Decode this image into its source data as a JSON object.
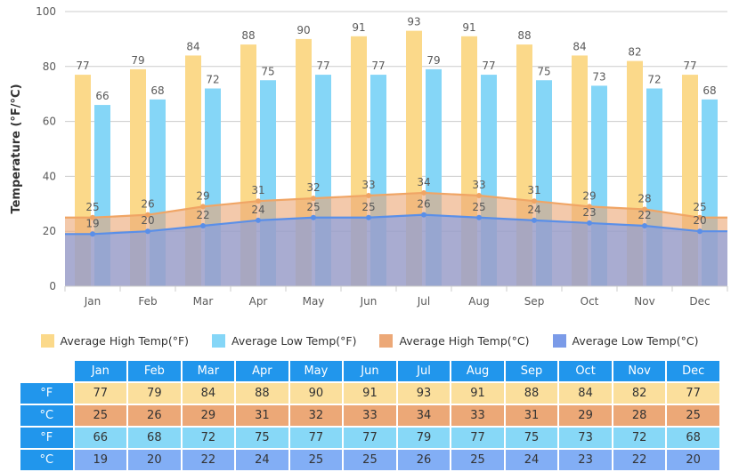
{
  "chart_data": {
    "type": "bar",
    "title": "",
    "xlabel": "",
    "ylabel": "Temperature (°F/°C)",
    "ylim": [
      0,
      100
    ],
    "yticks": [
      0,
      20,
      40,
      60,
      80,
      100
    ],
    "grid": true,
    "legend_position": "bottom",
    "categories": [
      "Jan",
      "Feb",
      "Mar",
      "Apr",
      "May",
      "Jun",
      "Jul",
      "Aug",
      "Sep",
      "Oct",
      "Nov",
      "Dec"
    ],
    "series": [
      {
        "name": "Average High Temp(°F)",
        "type": "bar",
        "color": "#fbd98a",
        "values": [
          77,
          79,
          84,
          88,
          90,
          91,
          93,
          91,
          88,
          84,
          82,
          77
        ]
      },
      {
        "name": "Average Low Temp(°F)",
        "type": "bar",
        "color": "#85d6f7",
        "values": [
          66,
          68,
          72,
          75,
          77,
          77,
          79,
          77,
          75,
          73,
          72,
          68
        ]
      },
      {
        "name": "Average High Temp(°C)",
        "type": "area",
        "color": "#eca877",
        "values": [
          25,
          26,
          29,
          31,
          32,
          33,
          34,
          33,
          31,
          29,
          28,
          25
        ]
      },
      {
        "name": "Average Low Temp(°C)",
        "type": "area",
        "color": "#7b9be8",
        "values": [
          19,
          20,
          22,
          24,
          25,
          25,
          26,
          25,
          24,
          23,
          22,
          20
        ]
      }
    ]
  },
  "legend": {
    "items": [
      {
        "label": "Average High Temp(°F)",
        "color": "#fbd98a"
      },
      {
        "label": "Average Low Temp(°F)",
        "color": "#85d6f7"
      },
      {
        "label": "Average High Temp(°C)",
        "color": "#eca877"
      },
      {
        "label": "Average Low Temp(°C)",
        "color": "#7b9be8"
      }
    ]
  },
  "table": {
    "corner": "",
    "columns": [
      "Jan",
      "Feb",
      "Mar",
      "Apr",
      "May",
      "Jun",
      "Jul",
      "Aug",
      "Sep",
      "Oct",
      "Nov",
      "Dec"
    ],
    "rows": [
      {
        "label": "°F",
        "style": "c-hf",
        "values": [
          77,
          79,
          84,
          88,
          90,
          91,
          93,
          91,
          88,
          84,
          82,
          77
        ]
      },
      {
        "label": "°C",
        "style": "c-hc",
        "values": [
          25,
          26,
          29,
          31,
          32,
          33,
          34,
          33,
          31,
          29,
          28,
          25
        ]
      },
      {
        "label": "°F",
        "style": "c-lf",
        "values": [
          66,
          68,
          72,
          75,
          77,
          77,
          79,
          77,
          75,
          73,
          72,
          68
        ]
      },
      {
        "label": "°C",
        "style": "c-lc",
        "values": [
          19,
          20,
          22,
          24,
          25,
          25,
          26,
          25,
          24,
          23,
          22,
          20
        ]
      }
    ]
  },
  "colors": {
    "grid": "#cccccc",
    "axis": "#cccccc",
    "tick_text": "#5a5a5a",
    "table_header": "#2196ec",
    "high_f_bar": "#fbd98a",
    "low_f_bar": "#85d6f7",
    "high_c_area": "#eca877",
    "low_c_area": "#7b9be8"
  }
}
